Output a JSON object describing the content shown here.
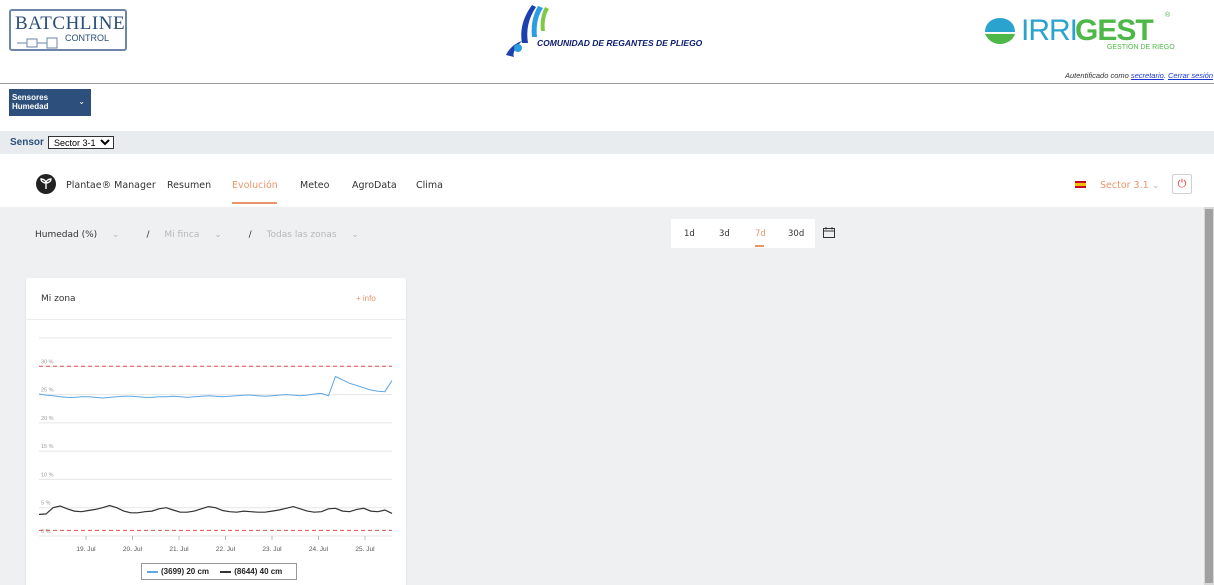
{
  "header": {
    "batchline": {
      "word1": "BATCHLINE",
      "word2": "CONTROL"
    },
    "community": "COMUNIDAD DE REGANTES DE PLIEGO",
    "irrigest": {
      "part1": "IRRI",
      "part2": "GEST",
      "tagline": "GESTIÓN DE RIEGO",
      "mark": "®"
    },
    "auth": {
      "prefix": "Autentificado como ",
      "user": "secretario",
      "logout": "Cerrar sesión"
    }
  },
  "sensors_menu": {
    "label_line1": "Sensores",
    "label_line2": "Humedad",
    "icon": "chevron-down-icon"
  },
  "sensor_bar": {
    "label": "Sensor",
    "selected": "Sector 3-1"
  },
  "nav": {
    "brand": "Plantae® Manager",
    "items": [
      "Resumen",
      "Evolución",
      "Meteo",
      "AgroData",
      "Clima"
    ],
    "active": "Evolución",
    "sector": "Sector 3.1",
    "sector_icon": "chevron-down-icon",
    "flag": "spain-flag-icon",
    "power_icon": "power-icon"
  },
  "filters": {
    "metric": "Humedad (%)",
    "sep": "/",
    "farm": "Mi finca",
    "zones": "Todas las zonas"
  },
  "ranges": {
    "items": [
      "1d",
      "3d",
      "7d",
      "30d"
    ],
    "active": "7d",
    "calendar_icon": "calendar-icon"
  },
  "card": {
    "title": "Mi zona",
    "more": "+ info",
    "chart_data": {
      "type": "line",
      "xlabel": "",
      "ylabel": "",
      "x_ticks": [
        "19. Jul",
        "20. Jul",
        "21. Jul",
        "22. Jul",
        "23. Jul",
        "24. Jul",
        "25. Jul"
      ],
      "y_ticks": [
        "0 %",
        "5 %",
        "10 %",
        "15 %",
        "20 %",
        "25 %",
        "30 %"
      ],
      "ylim": [
        0,
        35
      ],
      "thresholds": [
        30,
        1
      ],
      "threshold_color": "#e05252",
      "series": [
        {
          "name": "(3699) 20 cm",
          "color": "#5ea7e0",
          "values": [
            25.1,
            24.9,
            24.8,
            24.6,
            24.5,
            24.5,
            24.6,
            24.6,
            24.5,
            24.4,
            24.5,
            24.6,
            24.7,
            24.7,
            24.6,
            24.5,
            24.5,
            24.6,
            24.6,
            24.7,
            24.6,
            24.5,
            24.6,
            24.7,
            24.8,
            24.7,
            24.6,
            24.7,
            24.8,
            24.9,
            24.9,
            24.8,
            24.7,
            24.8,
            24.9,
            25.0,
            24.9,
            24.8,
            24.9,
            25.1,
            25.2,
            24.8,
            28.2,
            27.6,
            27.0,
            26.6,
            26.2,
            25.8,
            25.6,
            25.5,
            27.5
          ]
        },
        {
          "name": "(8644) 40 cm",
          "color": "#333333",
          "values": [
            3.8,
            3.9,
            5.0,
            5.3,
            4.8,
            4.4,
            4.3,
            4.5,
            4.7,
            5.0,
            5.4,
            5.0,
            4.4,
            4.1,
            4.1,
            4.3,
            4.4,
            4.8,
            5.0,
            4.6,
            4.2,
            4.2,
            4.4,
            4.8,
            5.2,
            5.0,
            4.5,
            4.3,
            4.2,
            4.4,
            4.3,
            4.2,
            4.2,
            4.4,
            4.6,
            4.9,
            5.2,
            4.8,
            4.4,
            4.2,
            4.3,
            4.8,
            4.9,
            4.4,
            4.3,
            4.7,
            4.9,
            4.4,
            4.3,
            4.6,
            4.0
          ]
        }
      ]
    }
  }
}
